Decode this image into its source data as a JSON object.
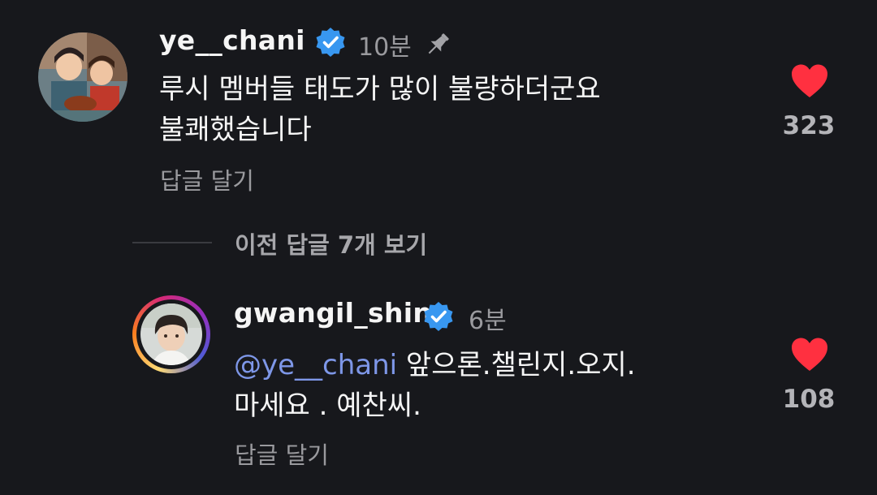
{
  "comments": [
    {
      "username": "ye__chani",
      "time": "10분",
      "text_line1": "루시 멤버들 태도가 많이 불량하더군요",
      "text_line2": "불쾌했습니다",
      "reply_label": "답글 달기",
      "like_count": "323",
      "pinned": true,
      "verified": true
    }
  ],
  "replies_toggle": {
    "label": "이전 답글 7개 보기"
  },
  "replies": [
    {
      "username": "gwangil_shin",
      "time": "6분",
      "mention": "@ye__chani",
      "text_line1_rest": " 앞으론.챌린지.오지.",
      "text_line2": "마세요 . 예찬씨.",
      "reply_label": "답글 달기",
      "like_count": "108",
      "verified": true
    }
  ],
  "colors": {
    "background": "#17181c",
    "verified_badge": "#3897f0",
    "like_heart": "#ff3040",
    "mention": "#7e97e8"
  }
}
